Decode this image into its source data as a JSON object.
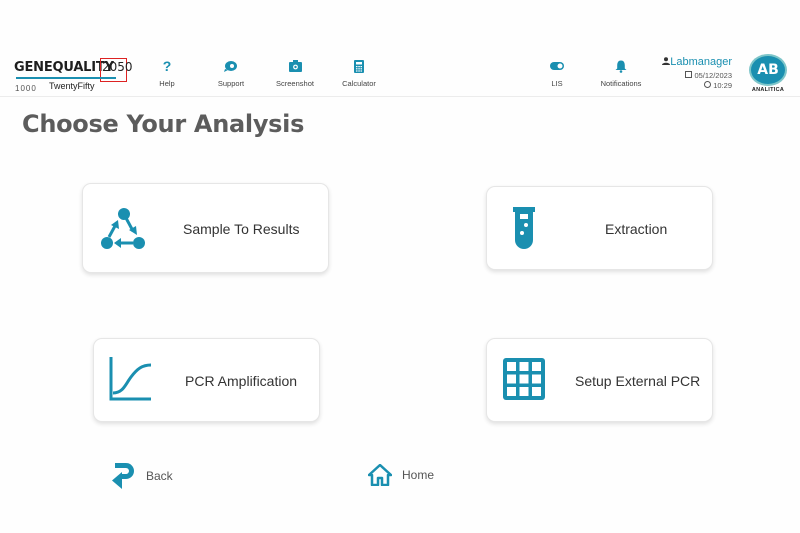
{
  "header": {
    "logo": {
      "brand": "GENEQUALITY",
      "year": "2050",
      "number": "1000",
      "subtitle": "TwentyFifty"
    },
    "nav": [
      {
        "label": "Help",
        "icon": "help-icon"
      },
      {
        "label": "Support",
        "icon": "support-icon"
      },
      {
        "label": "Screenshot",
        "icon": "camera-icon"
      },
      {
        "label": "Calculator",
        "icon": "calculator-icon"
      }
    ],
    "right_nav": [
      {
        "label": "LIS",
        "icon": "toggle-icon"
      },
      {
        "label": "Notifications",
        "icon": "bell-icon"
      }
    ],
    "user": {
      "name": "Labmanager",
      "date": "05/12/2023",
      "time": "10:29"
    },
    "company": {
      "initials": "AB",
      "name": "ANALITICA"
    }
  },
  "main": {
    "title": "Choose Your Analysis",
    "cards": [
      {
        "label": "Sample To Results",
        "icon": "workflow-cycle-icon"
      },
      {
        "label": "Extraction",
        "icon": "test-tube-icon"
      },
      {
        "label": "PCR Amplification",
        "icon": "amplification-curve-icon"
      },
      {
        "label": "Setup External PCR",
        "icon": "plate-grid-icon"
      }
    ]
  },
  "footer": {
    "back_label": "Back",
    "home_label": "Home"
  },
  "colors": {
    "accent": "#1a8fb0",
    "title": "#5c5c5c",
    "logo_box": "#dd2222"
  }
}
